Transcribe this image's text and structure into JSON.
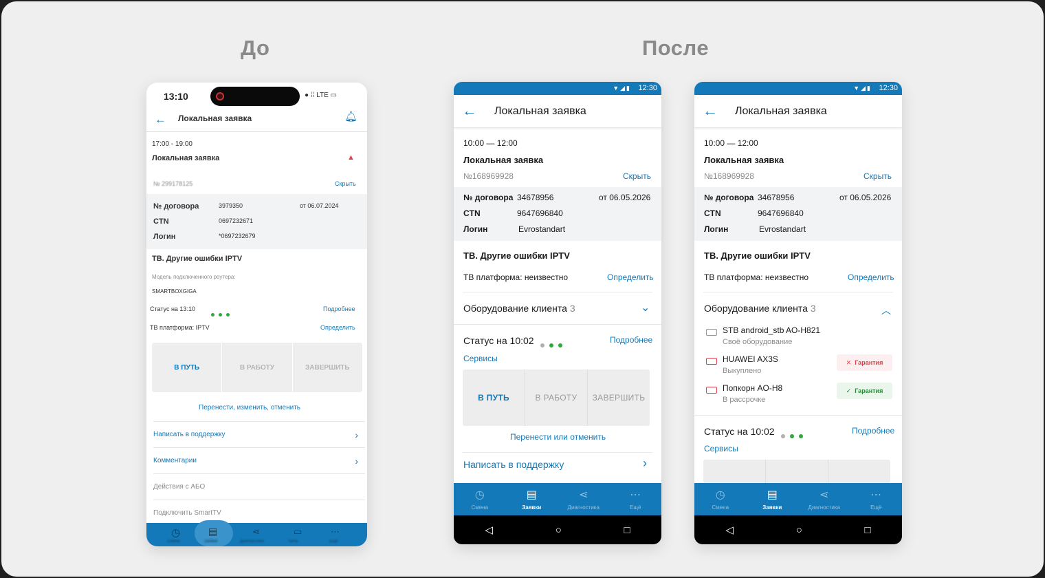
{
  "headings": {
    "before": "До",
    "after": "После"
  },
  "old_phone": {
    "time": "13:10",
    "status_icons": "LTE",
    "title": "Локальная заявка",
    "slot": "17:00 - 19:00",
    "request_type": "Локальная заявка",
    "request_no": "№ 299178125",
    "hide": "Скрыть",
    "contract_label": "№ договора",
    "contract_value": "3979350",
    "contract_date": "от 06.07.2024",
    "ctn_label": "CTN",
    "ctn_value": "0697232671",
    "login_label": "Логин",
    "login_value": "*0697232679",
    "problem": "ТВ. Другие ошибки IPTV",
    "router_label": "Модель подключенного роутера:",
    "router_value": "SMARTBOXGIGA",
    "status": "Статус на 13:10",
    "more": "Подробнее",
    "platform": "ТВ платформа: IPTV",
    "determine": "Определить",
    "btn_way": "В ПУТЬ",
    "btn_work": "В РАБОТУ",
    "btn_finish": "ЗАВЕРШИТЬ",
    "reschedule": "Перенести, изменить, отменить",
    "rows": [
      "Написать в поддержку",
      "Комментарии",
      "Действия с АБО",
      "Подключить SmartTV"
    ],
    "tabs": [
      "Смена",
      "Заявки",
      "Диагностика",
      "Чаты",
      "Ещё"
    ]
  },
  "new_common": {
    "time": "12:30",
    "title": "Локальная заявка",
    "slot": "10:00 — 12:00",
    "request_type": "Локальная заявка",
    "request_no": "№168969928",
    "hide": "Скрыть",
    "contract_label": "№ договора",
    "contract_value": "34678956",
    "contract_date": "от 06.05.2026",
    "ctn_label": "CTN",
    "ctn_value": "9647696840",
    "login_label": "Логин",
    "login_value": "Evrostandart",
    "problem": "ТВ. Другие ошибки IPTV",
    "platform": "ТВ платформа: неизвестно",
    "determine": "Определить",
    "equipment_label": "Оборудование клиента",
    "equipment_count": "3",
    "status": "Статус на 10:02",
    "more": "Подробнее",
    "services": "Сервисы",
    "tabs": [
      "Смена",
      "Заявки",
      "Диагностика",
      "Ещё"
    ]
  },
  "new_phone_1": {
    "btn_way": "В ПУТЬ",
    "btn_work": "В РАБОТУ",
    "btn_finish": "ЗАВЕРШИТЬ",
    "reschedule": "Перенести или отменить",
    "support": "Написать в поддержку"
  },
  "new_phone_2": {
    "equipment": [
      {
        "name": "STB android_stb AO-H821",
        "sub": "Своё оборудование"
      },
      {
        "name": "HUAWEI AX3S",
        "sub": "Выкуплено",
        "badge": "Гарантия"
      },
      {
        "name": "Попкорн AO-H8",
        "sub": "В рассрочке",
        "badge": "Гарантия"
      }
    ]
  },
  "colors": {
    "accent": "#1479b8",
    "dot_green": "#2eaa3c",
    "dot_grey": "#b0b0b0",
    "warn_red": "#e0424b"
  }
}
